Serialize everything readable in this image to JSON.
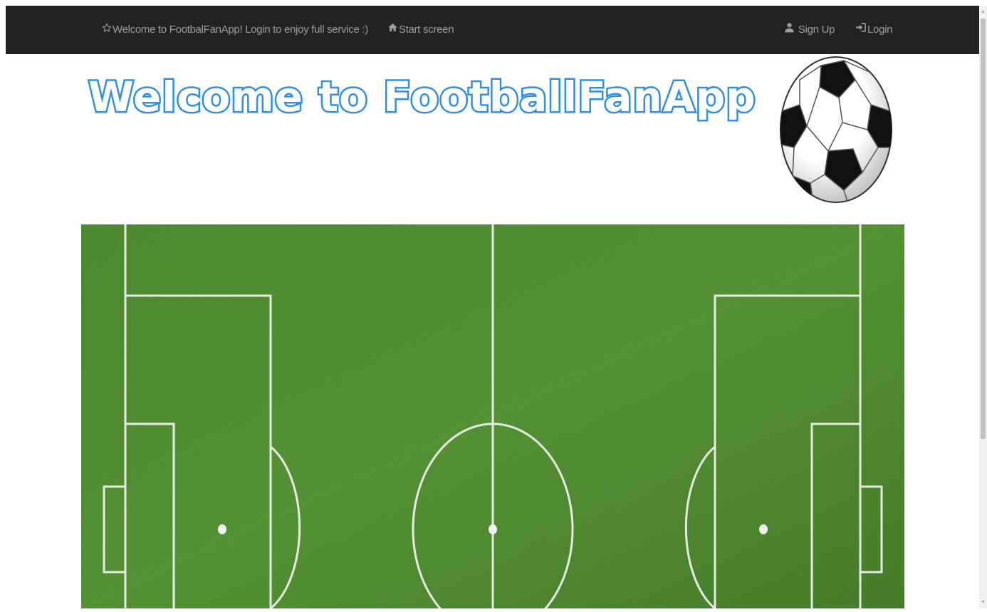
{
  "navbar": {
    "welcome_text": "Welcome to FootbalFanApp! Login to enjoy full service :)",
    "start_screen": "Start screen",
    "sign_up": "Sign Up",
    "login": "Login",
    "icons": {
      "welcome": "star-icon",
      "start": "home-icon",
      "signup": "user-icon",
      "login": "login-icon"
    }
  },
  "hero": {
    "title": "Welcome to FootballFanApp"
  },
  "colors": {
    "navbar_bg": "#222222",
    "nav_text": "#9d9d9d",
    "title_outline": "#2f8fe6",
    "grass": "#3d7a22",
    "field_lines": "#ffffff"
  }
}
